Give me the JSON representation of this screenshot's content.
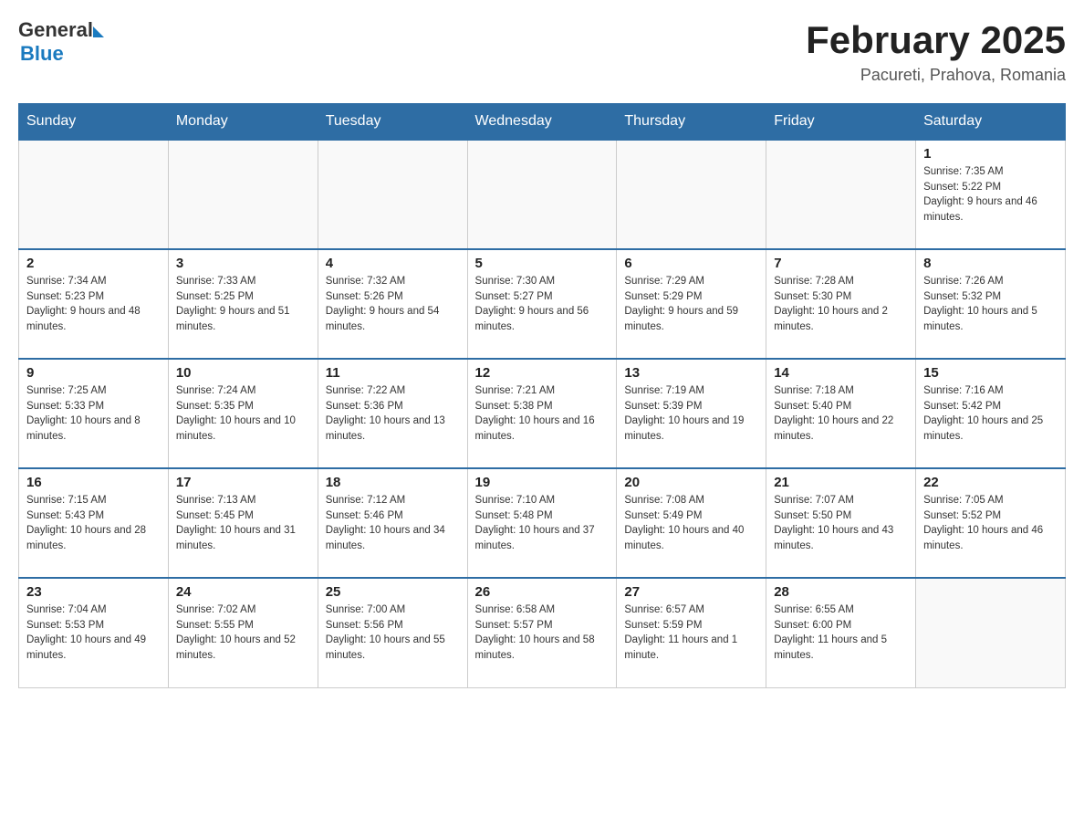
{
  "header": {
    "logo_general": "General",
    "logo_blue": "Blue",
    "month_title": "February 2025",
    "location": "Pacureti, Prahova, Romania"
  },
  "days_of_week": [
    "Sunday",
    "Monday",
    "Tuesday",
    "Wednesday",
    "Thursday",
    "Friday",
    "Saturday"
  ],
  "weeks": [
    [
      {
        "day": "",
        "info": ""
      },
      {
        "day": "",
        "info": ""
      },
      {
        "day": "",
        "info": ""
      },
      {
        "day": "",
        "info": ""
      },
      {
        "day": "",
        "info": ""
      },
      {
        "day": "",
        "info": ""
      },
      {
        "day": "1",
        "info": "Sunrise: 7:35 AM\nSunset: 5:22 PM\nDaylight: 9 hours and 46 minutes."
      }
    ],
    [
      {
        "day": "2",
        "info": "Sunrise: 7:34 AM\nSunset: 5:23 PM\nDaylight: 9 hours and 48 minutes."
      },
      {
        "day": "3",
        "info": "Sunrise: 7:33 AM\nSunset: 5:25 PM\nDaylight: 9 hours and 51 minutes."
      },
      {
        "day": "4",
        "info": "Sunrise: 7:32 AM\nSunset: 5:26 PM\nDaylight: 9 hours and 54 minutes."
      },
      {
        "day": "5",
        "info": "Sunrise: 7:30 AM\nSunset: 5:27 PM\nDaylight: 9 hours and 56 minutes."
      },
      {
        "day": "6",
        "info": "Sunrise: 7:29 AM\nSunset: 5:29 PM\nDaylight: 9 hours and 59 minutes."
      },
      {
        "day": "7",
        "info": "Sunrise: 7:28 AM\nSunset: 5:30 PM\nDaylight: 10 hours and 2 minutes."
      },
      {
        "day": "8",
        "info": "Sunrise: 7:26 AM\nSunset: 5:32 PM\nDaylight: 10 hours and 5 minutes."
      }
    ],
    [
      {
        "day": "9",
        "info": "Sunrise: 7:25 AM\nSunset: 5:33 PM\nDaylight: 10 hours and 8 minutes."
      },
      {
        "day": "10",
        "info": "Sunrise: 7:24 AM\nSunset: 5:35 PM\nDaylight: 10 hours and 10 minutes."
      },
      {
        "day": "11",
        "info": "Sunrise: 7:22 AM\nSunset: 5:36 PM\nDaylight: 10 hours and 13 minutes."
      },
      {
        "day": "12",
        "info": "Sunrise: 7:21 AM\nSunset: 5:38 PM\nDaylight: 10 hours and 16 minutes."
      },
      {
        "day": "13",
        "info": "Sunrise: 7:19 AM\nSunset: 5:39 PM\nDaylight: 10 hours and 19 minutes."
      },
      {
        "day": "14",
        "info": "Sunrise: 7:18 AM\nSunset: 5:40 PM\nDaylight: 10 hours and 22 minutes."
      },
      {
        "day": "15",
        "info": "Sunrise: 7:16 AM\nSunset: 5:42 PM\nDaylight: 10 hours and 25 minutes."
      }
    ],
    [
      {
        "day": "16",
        "info": "Sunrise: 7:15 AM\nSunset: 5:43 PM\nDaylight: 10 hours and 28 minutes."
      },
      {
        "day": "17",
        "info": "Sunrise: 7:13 AM\nSunset: 5:45 PM\nDaylight: 10 hours and 31 minutes."
      },
      {
        "day": "18",
        "info": "Sunrise: 7:12 AM\nSunset: 5:46 PM\nDaylight: 10 hours and 34 minutes."
      },
      {
        "day": "19",
        "info": "Sunrise: 7:10 AM\nSunset: 5:48 PM\nDaylight: 10 hours and 37 minutes."
      },
      {
        "day": "20",
        "info": "Sunrise: 7:08 AM\nSunset: 5:49 PM\nDaylight: 10 hours and 40 minutes."
      },
      {
        "day": "21",
        "info": "Sunrise: 7:07 AM\nSunset: 5:50 PM\nDaylight: 10 hours and 43 minutes."
      },
      {
        "day": "22",
        "info": "Sunrise: 7:05 AM\nSunset: 5:52 PM\nDaylight: 10 hours and 46 minutes."
      }
    ],
    [
      {
        "day": "23",
        "info": "Sunrise: 7:04 AM\nSunset: 5:53 PM\nDaylight: 10 hours and 49 minutes."
      },
      {
        "day": "24",
        "info": "Sunrise: 7:02 AM\nSunset: 5:55 PM\nDaylight: 10 hours and 52 minutes."
      },
      {
        "day": "25",
        "info": "Sunrise: 7:00 AM\nSunset: 5:56 PM\nDaylight: 10 hours and 55 minutes."
      },
      {
        "day": "26",
        "info": "Sunrise: 6:58 AM\nSunset: 5:57 PM\nDaylight: 10 hours and 58 minutes."
      },
      {
        "day": "27",
        "info": "Sunrise: 6:57 AM\nSunset: 5:59 PM\nDaylight: 11 hours and 1 minute."
      },
      {
        "day": "28",
        "info": "Sunrise: 6:55 AM\nSunset: 6:00 PM\nDaylight: 11 hours and 5 minutes."
      },
      {
        "day": "",
        "info": ""
      }
    ]
  ]
}
